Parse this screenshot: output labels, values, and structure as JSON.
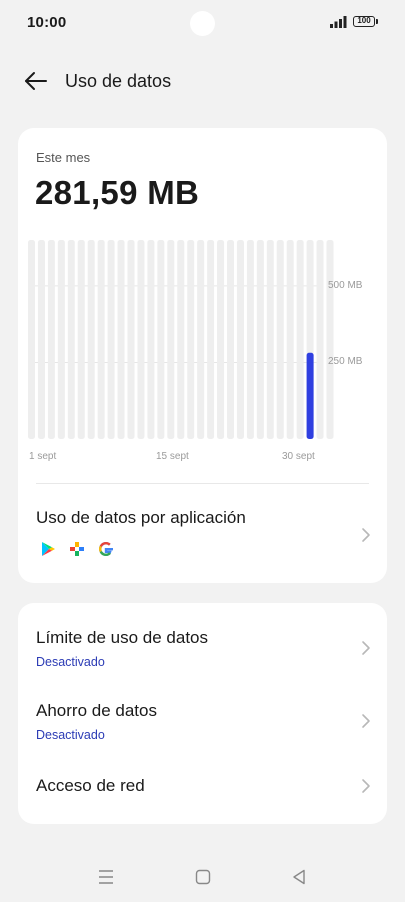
{
  "status_bar": {
    "time": "10:00",
    "battery": "100",
    "icons": [
      "signal-icon",
      "battery-icon"
    ]
  },
  "header": {
    "title": "Uso de datos",
    "back_icon": "back-arrow-icon"
  },
  "summary": {
    "period_label": "Este mes",
    "total": "281,59 MB"
  },
  "chart_data": {
    "type": "bar",
    "x_tick_labels": [
      "1 sept",
      "15 sept",
      "30 sept"
    ],
    "y_tick_labels": [
      "500 MB",
      "250 MB"
    ],
    "ylim": [
      0,
      650
    ],
    "grid": true,
    "day_count": 30,
    "values": [
      0,
      0,
      0,
      0,
      0,
      0,
      0,
      0,
      0,
      0,
      0,
      0,
      0,
      0,
      0,
      0,
      0,
      0,
      0,
      0,
      0,
      0,
      0,
      0,
      0,
      0,
      0,
      0,
      281.59,
      0,
      0
    ],
    "colors": {
      "active": "#2f3fe0",
      "track": "#eeeeee",
      "grid": "#e6e6e6"
    }
  },
  "app_usage": {
    "title": "Uso de datos por aplicación",
    "apps": [
      "google-play-store-icon",
      "photos-app-icon",
      "google-icon"
    ]
  },
  "settings": {
    "limit": {
      "title": "Límite de uso de datos",
      "status": "Desactivado"
    },
    "saver": {
      "title": "Ahorro de datos",
      "status": "Desactivado"
    },
    "network": {
      "title": "Acceso de red"
    }
  },
  "nav": {
    "icons": [
      "menu-nav-icon",
      "home-nav-icon",
      "back-nav-icon"
    ]
  },
  "colors": {
    "accent": "#2b3bb5",
    "background": "#f2f2f2",
    "card": "#ffffff"
  }
}
